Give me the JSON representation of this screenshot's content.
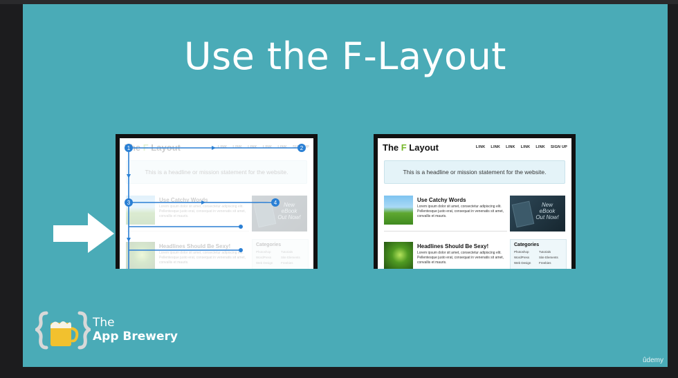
{
  "slide": {
    "title": "Use the F-Layout"
  },
  "mockup": {
    "logo_prefix": "The ",
    "logo_f": "F",
    "logo_suffix": " Layout",
    "nav": [
      "LINK",
      "LINK",
      "LINK",
      "LINK",
      "LINK",
      "SIGN UP"
    ],
    "banner": "This is a headline or mission statement for the website.",
    "articles": [
      {
        "title": "Use Catchy Words",
        "body": "Lorem ipsum dolor sit amet, consectetur adipiscing elit. Pellentesque justo erat, consequat in venenatis sit amet, convallis et mauris."
      },
      {
        "title": "Headlines Should Be Sexy!",
        "body": "Lorem ipsum dolor sit amet, consectetur adipiscing elit. Pellentesque justo erat, consequat in venenatis sit amet, convallis et mauris."
      }
    ],
    "ad_text": [
      "New",
      "eBook",
      "Out Now!"
    ],
    "categories_title": "Categories",
    "categories": [
      "Photoshop",
      "Tutorials",
      "WordPress",
      "Site Elements",
      "Web Design",
      "Freebies"
    ]
  },
  "eye_path_markers": [
    "1",
    "2",
    "3",
    "4"
  ],
  "brand": {
    "line1": "The",
    "line2": "App Brewery"
  },
  "watermark": "ûdemy",
  "colors": {
    "slide_bg": "#4aabb7",
    "eye_path": "#2a7fd4",
    "logo_accent": "#76b82a"
  }
}
